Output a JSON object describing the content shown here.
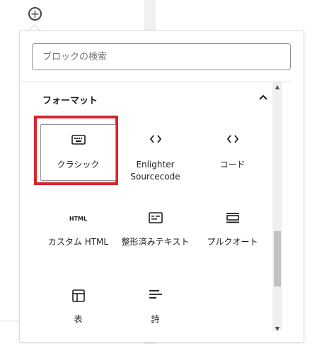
{
  "inserter": {
    "add_symbol": "+",
    "search_placeholder": "ブロックの検索",
    "panel_title": "フォーマット",
    "blocks": [
      {
        "label": "クラシック",
        "icon": "keyboard-icon"
      },
      {
        "label": "Enlighter Sourcecode",
        "icon": "code-icon"
      },
      {
        "label": "コード",
        "icon": "code-icon"
      },
      {
        "label": "カスタム HTML",
        "icon": "html-icon",
        "icon_text": "HTML"
      },
      {
        "label": "整形済みテキスト",
        "icon": "preformatted-icon"
      },
      {
        "label": "プルクオート",
        "icon": "pullquote-icon"
      },
      {
        "label": "表",
        "icon": "table-icon"
      },
      {
        "label": "詩",
        "icon": "verse-icon"
      }
    ]
  },
  "colors": {
    "highlight": "#d6262c",
    "icon": "#1e1e1e",
    "border": "#dcdcde"
  }
}
